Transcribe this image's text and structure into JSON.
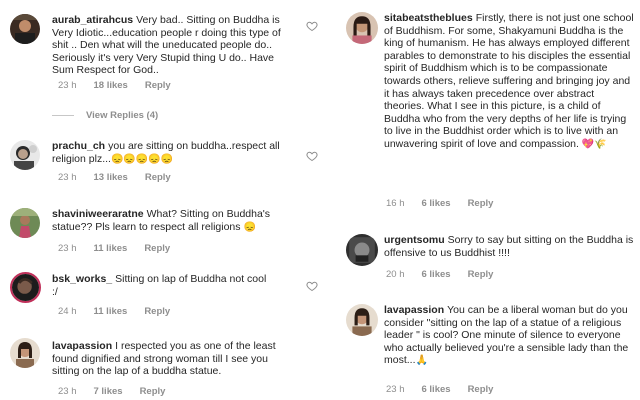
{
  "left_comments": [
    {
      "user": "aurab_atirahcus",
      "text": "Very bad.. Sitting on Buddha is Very Idiotic...education people r doing this type of shit .. Den what will the uneducated people do.. Seriously it's very Very Stupid thing U do.. Have Sum Respect for God..",
      "time": "23 h",
      "likes": "18 likes",
      "reply": "Reply",
      "view_replies": "View Replies (4)"
    },
    {
      "user": "prachu_ch",
      "text": "you are sitting on buddha..respect all religion  plz...",
      "emoji": "😞😞😞😞😞",
      "time": "23 h",
      "likes": "13 likes",
      "reply": "Reply"
    },
    {
      "user": "shaviniweeraratne",
      "text": "What? Sitting on Buddha's statue?? Pls learn to respect all religions",
      "emoji": "😞",
      "time": "23 h",
      "likes": "11 likes",
      "reply": "Reply"
    },
    {
      "user": "bsk_works_",
      "text": "Sitting on lap of Buddha not cool :/",
      "time": "24 h",
      "likes": "11 likes",
      "reply": "Reply"
    },
    {
      "user": "lavapassion",
      "text": "I respected you as one of the least found dignified and strong woman till I see you sitting on the lap of a buddha statue.",
      "time": "23 h",
      "likes": "7 likes",
      "reply": "Reply"
    }
  ],
  "right_comments": [
    {
      "user": "sitabeatstheblues",
      "text": "Firstly, there is not just one school of Buddhism. For some, Shakyamuni Buddha is the king of humanism. He has always employed different parables to demonstrate to his disciples the essential spirit of Buddhism which is to be compassionate towards others, relieve suffering and bringing joy and it has always taken precedence over abstract theories. What I see in this picture, is a child of Buddha who from the very depths of her life is trying to live in the Buddhist order which is to live  with an unwavering spirit of love and compassion.",
      "emoji": "💖🌾",
      "time": "16 h",
      "likes": "6 likes",
      "reply": "Reply"
    },
    {
      "user": "urgentsomu",
      "text": "Sorry to say but sitting on the Buddha is offensive to us Buddhist !!!!",
      "time": "20 h",
      "likes": "6 likes",
      "reply": "Reply"
    },
    {
      "user": "lavapassion",
      "text": "You can be a liberal woman but do you consider \"sitting on the lap of a statue of a religious leader \" is cool? One minute of silence to everyone who actually believed you're a sensible lady than the most...",
      "emoji": "🙏",
      "time": "23 h",
      "likes": "6 likes",
      "reply": "Reply"
    }
  ],
  "icons": {
    "like": "heart-outline-icon"
  },
  "colors": {
    "text": "#262626",
    "meta": "#8e8e8e",
    "background": "#ffffff"
  }
}
